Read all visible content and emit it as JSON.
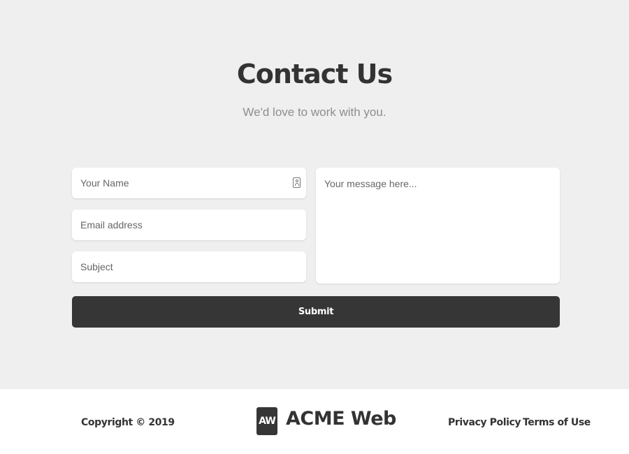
{
  "contact": {
    "title": "Contact Us",
    "subtitle": "We'd love to work with you."
  },
  "form": {
    "name_placeholder": "Your Name",
    "email_placeholder": "Email address",
    "subject_placeholder": "Subject",
    "message_placeholder": "Your message here...",
    "submit_label": "Submit",
    "name_icon": "contact-card-icon"
  },
  "footer": {
    "copyright": "Copyright © 2019",
    "logo_mark": "AW",
    "logo_text": "ACME Web",
    "links": [
      {
        "label": "Privacy Policy"
      },
      {
        "label": "Terms of Use"
      }
    ]
  },
  "colors": {
    "background": "#efefef",
    "accent": "#363636",
    "footer_bg": "#ffffff"
  }
}
